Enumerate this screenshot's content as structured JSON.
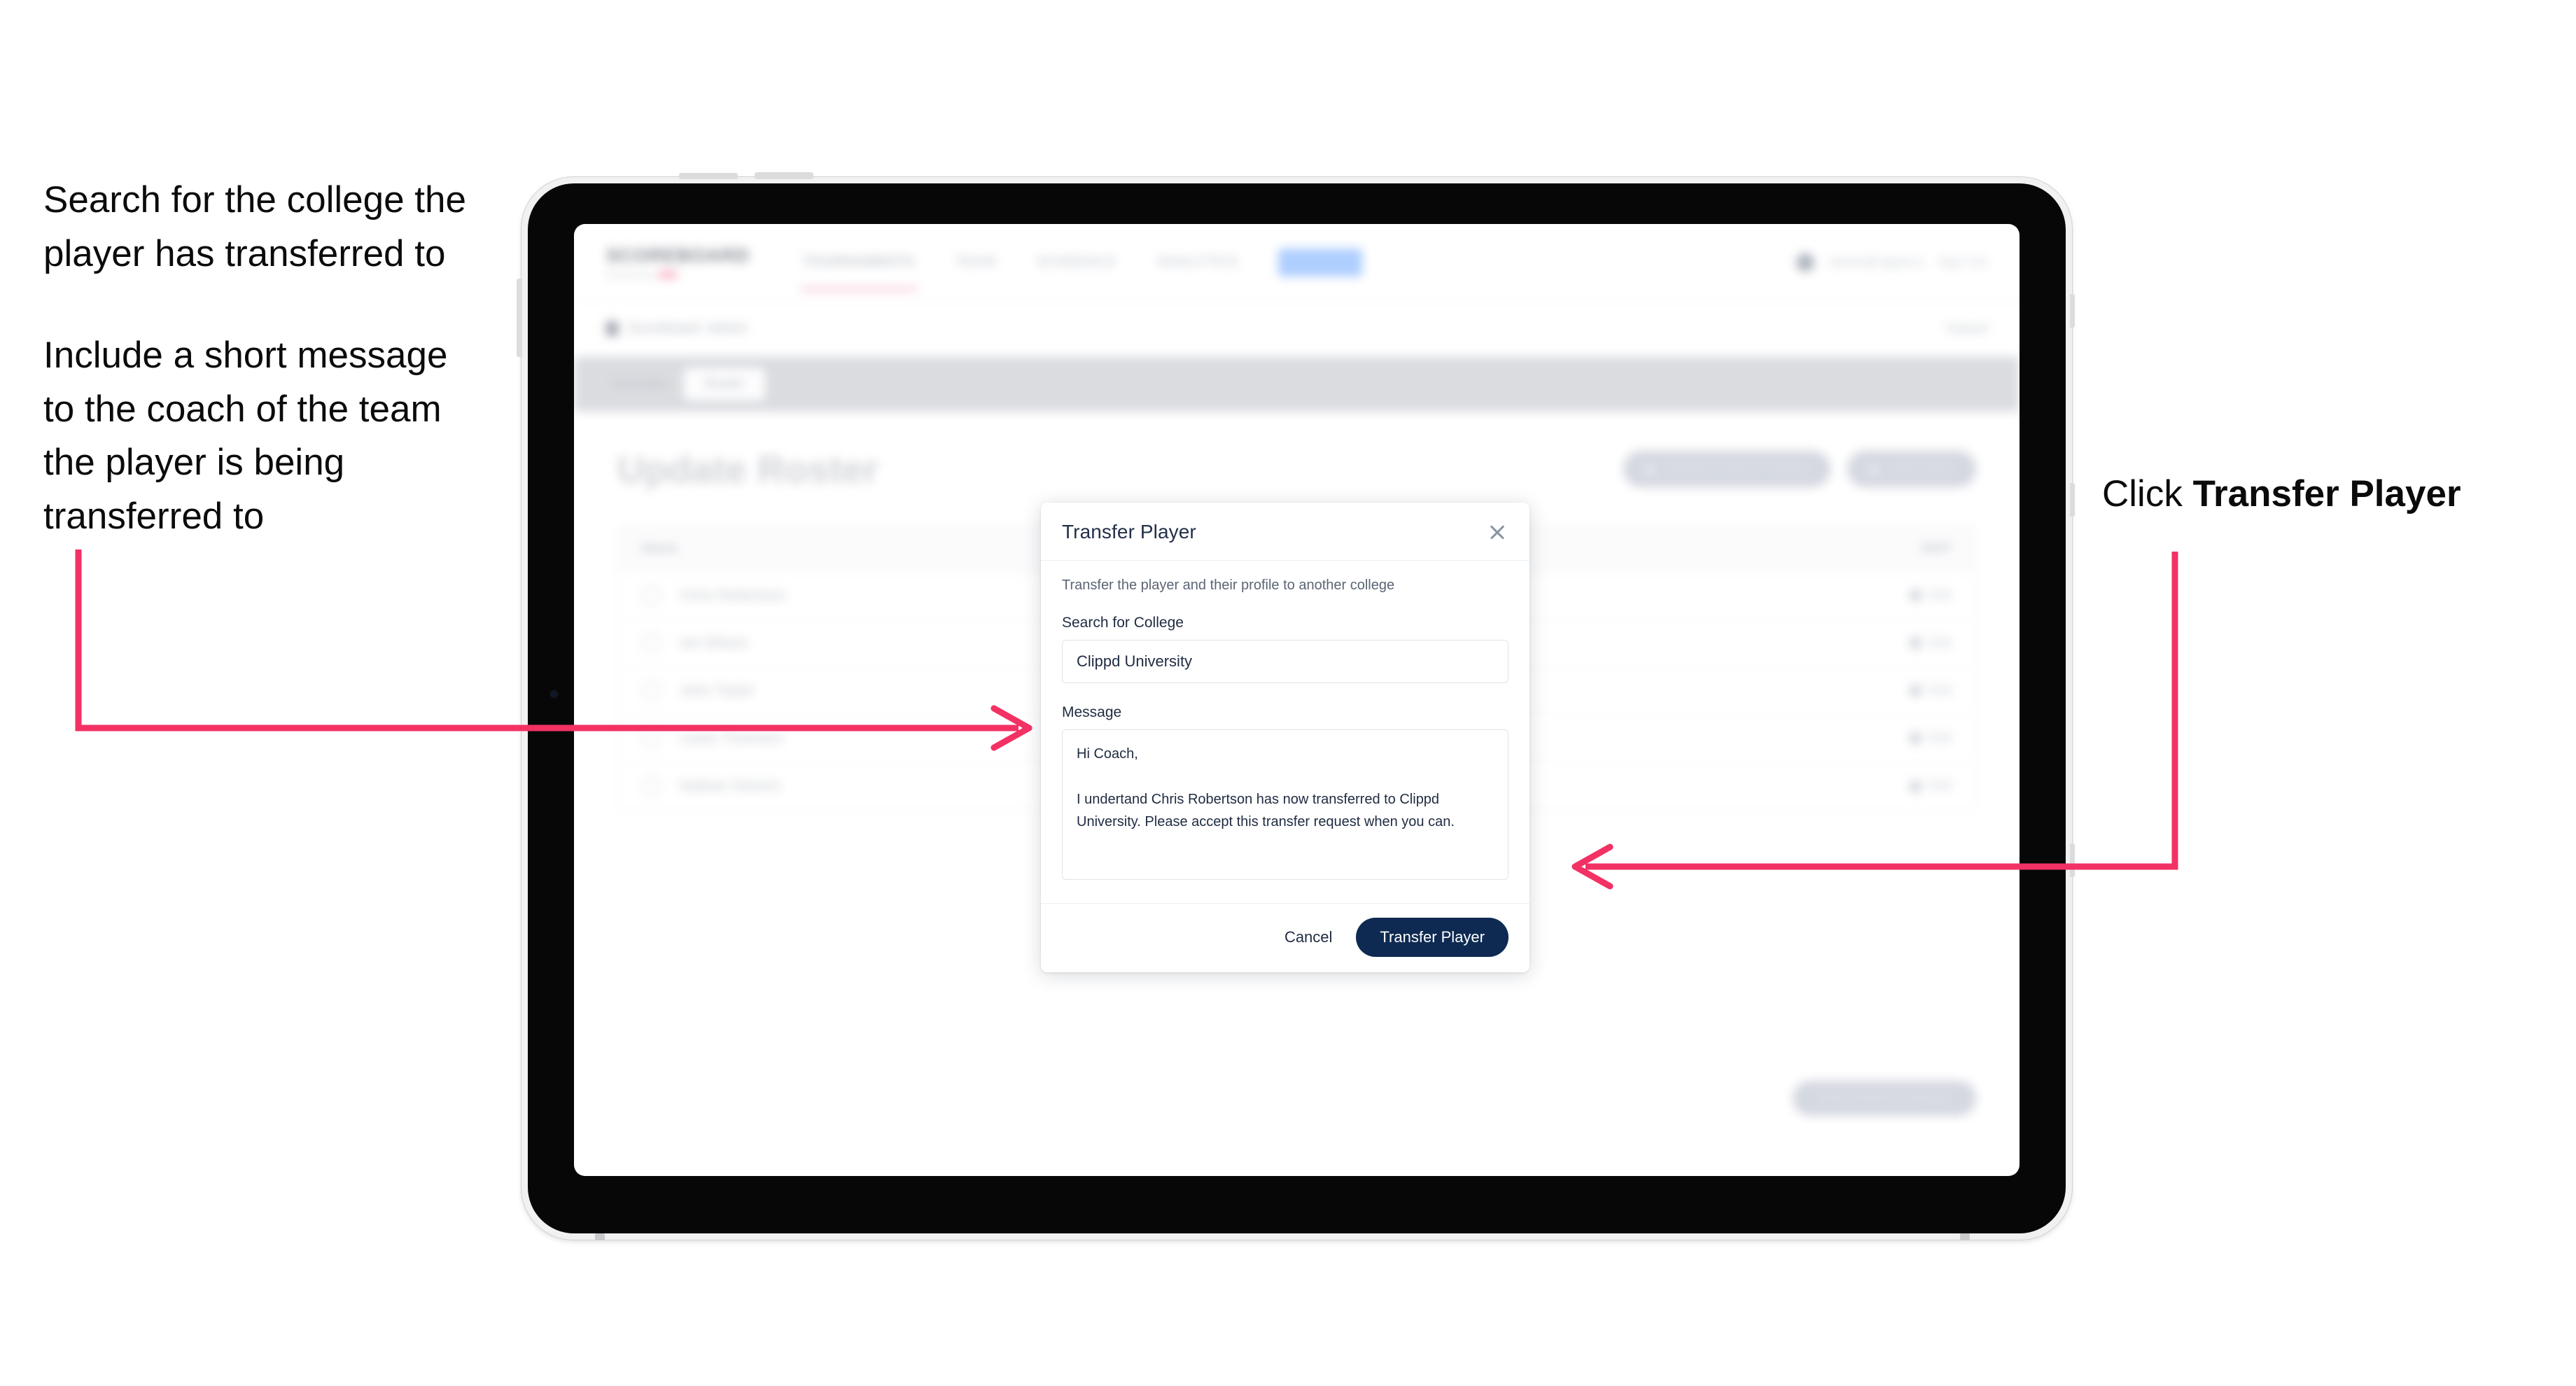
{
  "annotations": {
    "left": [
      "Search for the college the player has transferred to",
      "Include a short message to the coach of the team the player is being transferred to"
    ],
    "right_prefix": "Click ",
    "right_bold": "Transfer Player",
    "arrow_color": "#F23164"
  },
  "app": {
    "brand": {
      "word": "SCOREBOARD",
      "subtitle": "Powered by",
      "accent_color": "#F9A8BD"
    },
    "nav": [
      {
        "label": "TOURNAMENTS"
      },
      {
        "label": "TEAM"
      },
      {
        "label": "SCHEDULE"
      },
      {
        "label": "ANALYTICS"
      },
      {
        "label": "ROSTER"
      }
    ],
    "nav_right": {
      "user": "admin@clippd.io",
      "sign_out": "Sign Out"
    },
    "breadcrumb": {
      "icon": "grid-icon",
      "text": "Scoreboard",
      "sub": "Admin",
      "right": "Cancel"
    },
    "tabs": [
      {
        "label": "Overview",
        "active": false
      },
      {
        "label": "Roster",
        "active": true
      }
    ],
    "page_title": "Update Roster",
    "header_actions": [
      {
        "label": "Request Player Transfer",
        "icon": "transfer-icon"
      },
      {
        "label": "Add Player",
        "icon": "plus-icon"
      }
    ],
    "roster": {
      "col_name": "Name",
      "col_edit": "EDIT",
      "rows": [
        {
          "name": "Chris Robertson",
          "action": "Edit"
        },
        {
          "name": "Ian Wilson",
          "action": "Edit"
        },
        {
          "name": "John Taylor",
          "action": "Edit"
        },
        {
          "name": "Lewis Thomson",
          "action": "Edit"
        },
        {
          "name": "Nathan Simons",
          "action": "Edit"
        }
      ]
    },
    "bottom_cta": "Save Roster Changes"
  },
  "modal": {
    "title": "Transfer Player",
    "close_icon": "close-icon",
    "description": "Transfer the player and their profile to another college",
    "college_label": "Search for College",
    "college_value": "Clippd University",
    "college_placeholder": "Search for College",
    "message_label": "Message",
    "message_value": "Hi Coach,\n\nI undertand Chris Robertson has now transferred to Clippd University. Please accept this transfer request when you can.",
    "message_placeholder": "Message",
    "cancel_label": "Cancel",
    "submit_label": "Transfer Player",
    "submit_color": "#0E2A52"
  }
}
